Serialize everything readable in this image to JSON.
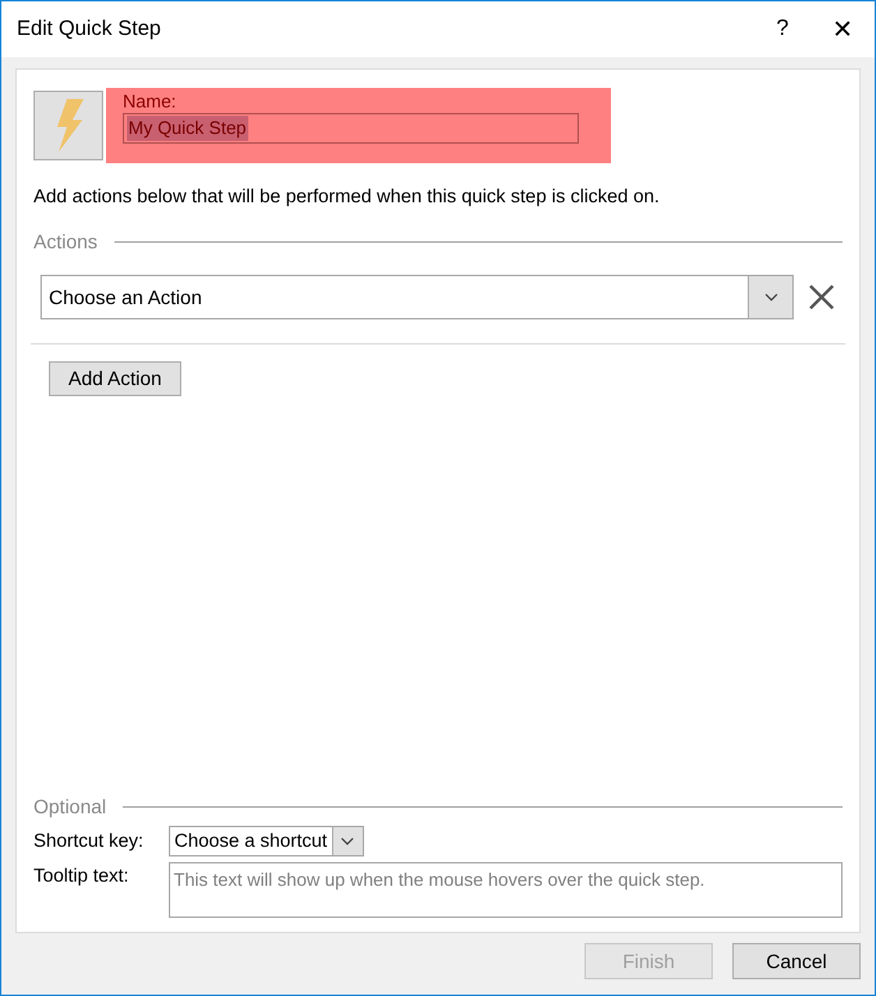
{
  "window": {
    "title": "Edit Quick Step",
    "help": "?",
    "close": "✕"
  },
  "name_section": {
    "highlighted": true,
    "label": "Name:",
    "value": "My Quick Step",
    "value_selected": true
  },
  "description": "Add actions below that will be performed when this quick step is clicked on.",
  "actions": {
    "heading": "Actions",
    "action_select": "Choose an Action",
    "add_button": "Add Action"
  },
  "optional": {
    "heading": "Optional",
    "shortcut_label": "Shortcut key:",
    "shortcut_select": "Choose a shortcut",
    "tooltip_label": "Tooltip text:",
    "tooltip_placeholder": "This text will show up when the mouse hovers over the quick step."
  },
  "buttons": [
    {
      "label": "Finish",
      "disabled": true
    },
    {
      "label": "Cancel",
      "disabled": false
    }
  ]
}
